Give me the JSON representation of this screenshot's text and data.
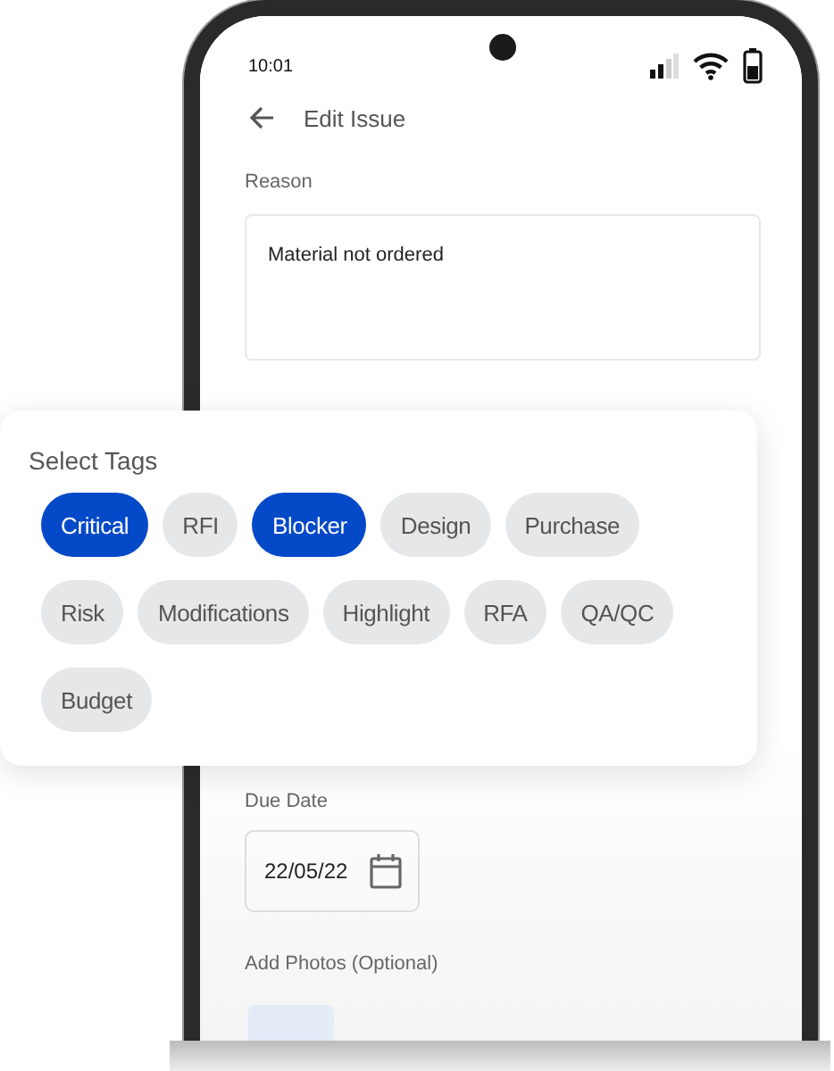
{
  "status_bar": {
    "time": "10:01"
  },
  "header": {
    "title": "Edit Issue"
  },
  "reason": {
    "label": "Reason",
    "value": "Material not ordered"
  },
  "tags": {
    "title": "Select Tags",
    "items": [
      {
        "label": "Critical",
        "selected": true
      },
      {
        "label": "RFI",
        "selected": false
      },
      {
        "label": "Blocker",
        "selected": true
      },
      {
        "label": "Design",
        "selected": false
      },
      {
        "label": "Purchase",
        "selected": false
      },
      {
        "label": "Risk",
        "selected": false
      },
      {
        "label": "Modifications",
        "selected": false
      },
      {
        "label": "Highlight",
        "selected": false
      },
      {
        "label": "RFA",
        "selected": false
      },
      {
        "label": "QA/QC",
        "selected": false
      },
      {
        "label": "Budget",
        "selected": false
      }
    ]
  },
  "due_date": {
    "label": "Due Date",
    "value": "22/05/22"
  },
  "photos": {
    "label": "Add Photos (Optional)"
  }
}
